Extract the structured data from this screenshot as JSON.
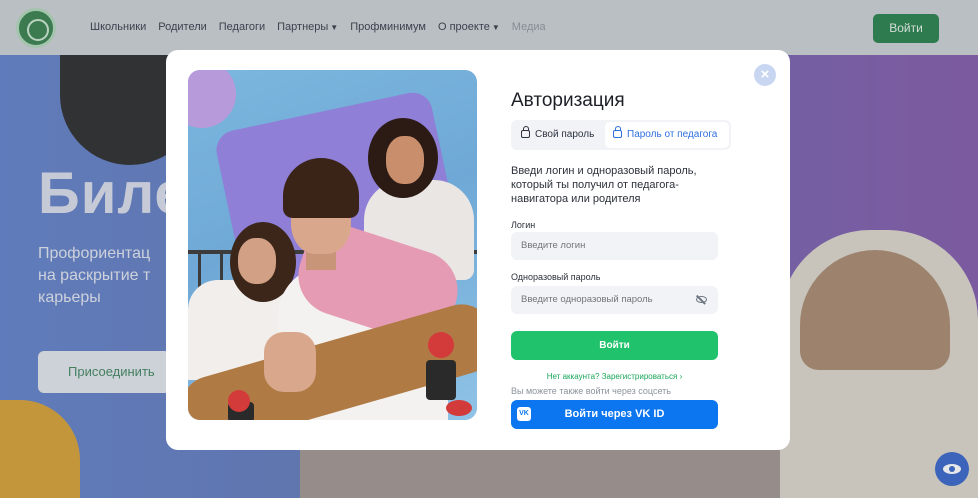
{
  "header": {
    "nav": [
      {
        "label": "Школьники",
        "chevron": false
      },
      {
        "label": "Родители",
        "chevron": false
      },
      {
        "label": "Педагоги",
        "chevron": false
      },
      {
        "label": "Партнеры",
        "chevron": true
      },
      {
        "label": "Профминимум",
        "chevron": false
      },
      {
        "label": "О проекте",
        "chevron": true
      },
      {
        "label": "Медиа",
        "chevron": false,
        "muted": true
      }
    ],
    "login_label": "Войти"
  },
  "background": {
    "title": "Биле",
    "subtitle_lines": [
      "Профориентац",
      "на раскрытие т",
      "карьеры"
    ],
    "join_label": "Присоединить"
  },
  "modal": {
    "title": "Авторизация",
    "tabs": {
      "own_password": "Свой пароль",
      "teacher_password": "Пароль от педагога"
    },
    "description": "Введи логин и одноразовый пароль, который ты получил от педагога-навигатора или родителя",
    "login": {
      "label": "Логин",
      "placeholder": "Введите логин"
    },
    "password": {
      "label": "Одноразовый пароль",
      "placeholder": "Введите одноразовый пароль"
    },
    "submit_label": "Войти",
    "register_link": "Нет аккаунта? Зарегистрироваться ›",
    "social_hint": "Вы можете также войти через соцсеть",
    "vk_button": "Войти через VK ID",
    "vk_icon_text": "VK"
  },
  "colors": {
    "brand_green": "#1f7a45",
    "submit_green": "#21c26c",
    "vk_blue": "#0b76f0",
    "tab_active": "#2f6fe0"
  }
}
